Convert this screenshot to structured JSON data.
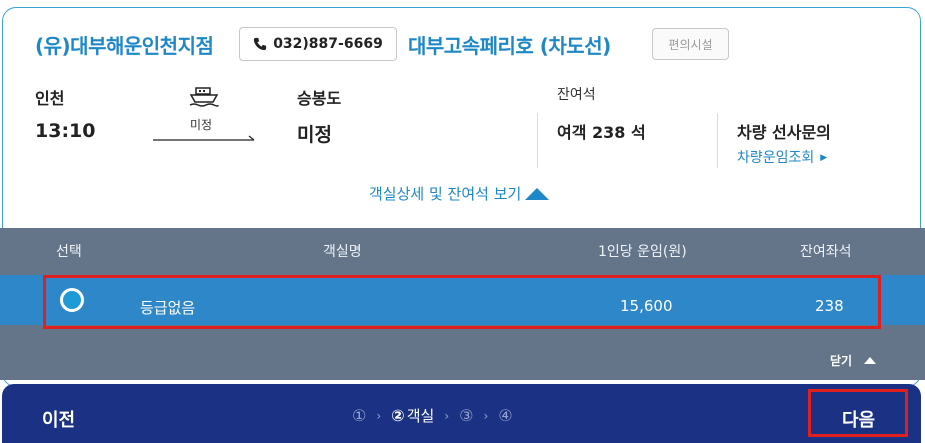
{
  "header": {
    "company": "(유)대부해운인천지점",
    "phone": "032)887-6669",
    "ship_name": "대부고속페리호 (차도선)",
    "facility_button": "편의시설"
  },
  "route": {
    "departure_label": "인천",
    "departure_time": "13:10",
    "via": "미정",
    "arrival_label": "승봉도",
    "arrival_name": "미정"
  },
  "seats": {
    "remaining_label": "잔여석",
    "remaining_value": "여객 238 석"
  },
  "vehicle": {
    "title": "차량 선사문의",
    "link_label": "차량운임조회"
  },
  "detail_toggle": "객실상세 및 잔여석 보기",
  "table": {
    "headers": [
      "선택",
      "객실명",
      "1인당 운임(원)",
      "잔여좌석"
    ],
    "rows": [
      {
        "room": "등급없음",
        "fare": "15,600",
        "remaining": "238",
        "selected": true
      }
    ],
    "close_label": "닫기"
  },
  "footer": {
    "prev": "이전",
    "steps": [
      "①",
      "②",
      "③",
      "④"
    ],
    "current_step_label": "객실",
    "next": "다음"
  },
  "colors": {
    "accent": "#1e88c7",
    "table_bg": "#64758a",
    "selected_row": "#2e87c8",
    "footer_bg": "#1a3184",
    "highlight": "#e0201e"
  },
  "icons": [
    "phone-icon",
    "ship-icon",
    "arrow-right-icon",
    "triangle-right-icon",
    "triangle-up-icon"
  ]
}
